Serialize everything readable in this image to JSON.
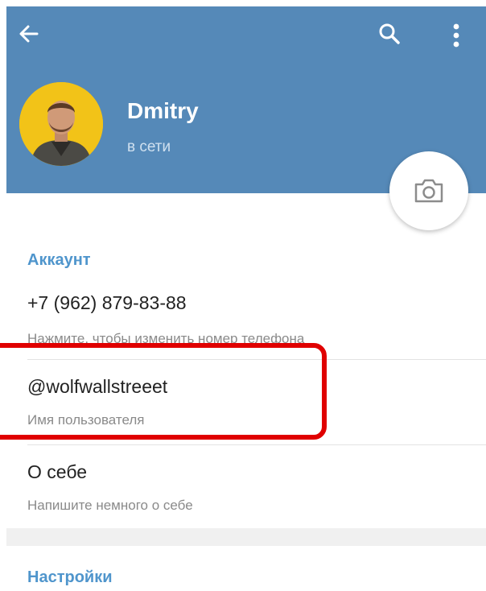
{
  "header": {
    "name": "Dmitry",
    "status": "в сети",
    "color": "#5589b8"
  },
  "account": {
    "section_title": "Аккаунт",
    "phone": "+7 (962) 879-83-88",
    "phone_hint": "Нажмите, чтобы изменить номер телефона",
    "username": "@wolfwallstreeet",
    "username_hint": "Имя пользователя",
    "bio_title": "О себе",
    "bio_hint": "Напишите немного о себе"
  },
  "settings": {
    "section_title": "Настройки"
  },
  "icons": [
    "back-arrow-icon",
    "search-icon",
    "more-vertical-icon",
    "camera-icon"
  ],
  "highlight_color": "#e00000"
}
